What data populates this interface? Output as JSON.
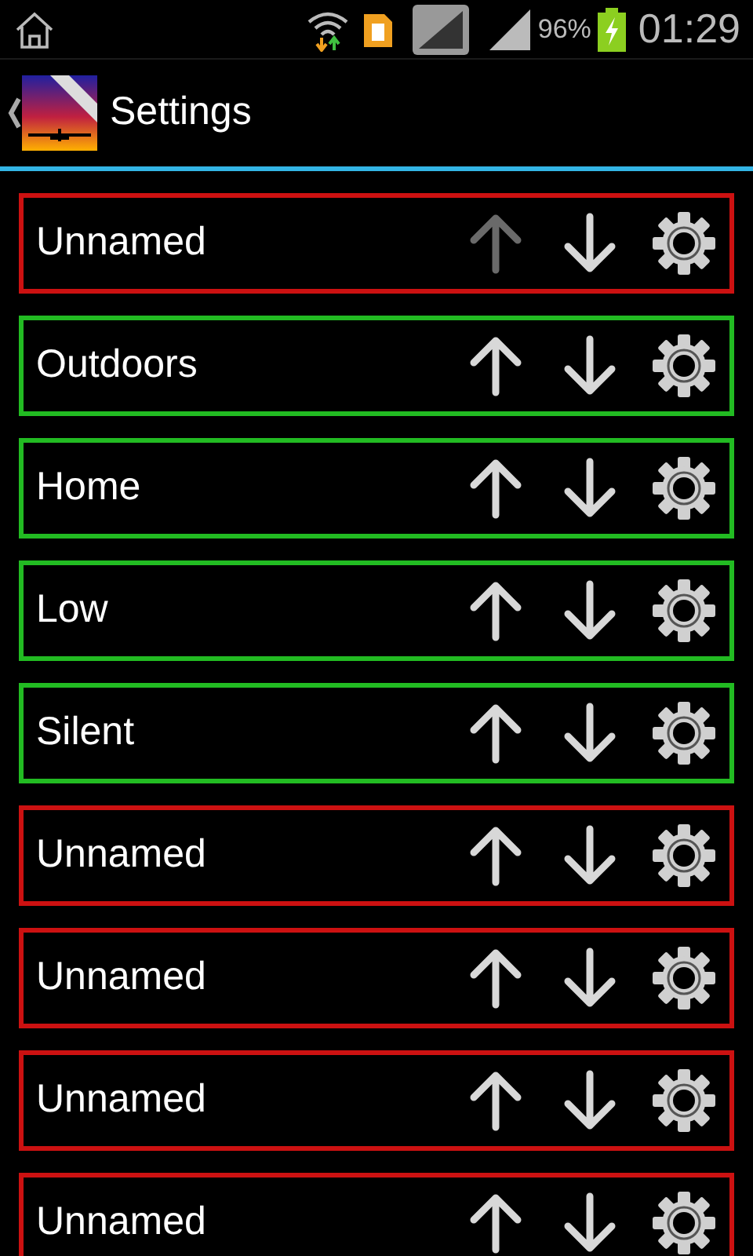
{
  "status_bar": {
    "battery": "96%",
    "time": "01:29"
  },
  "header": {
    "title": "Settings"
  },
  "profiles": [
    {
      "name": "Unnamed",
      "color": "#cc1111",
      "up_disabled": true
    },
    {
      "name": "Outdoors",
      "color": "#22bb22",
      "up_disabled": false
    },
    {
      "name": "Home",
      "color": "#22bb22",
      "up_disabled": false
    },
    {
      "name": "Low",
      "color": "#22bb22",
      "up_disabled": false
    },
    {
      "name": "Silent",
      "color": "#22bb22",
      "up_disabled": false
    },
    {
      "name": "Unnamed",
      "color": "#cc1111",
      "up_disabled": false
    },
    {
      "name": "Unnamed",
      "color": "#cc1111",
      "up_disabled": false
    },
    {
      "name": "Unnamed",
      "color": "#cc1111",
      "up_disabled": false
    },
    {
      "name": "Unnamed",
      "color": "#cc1111",
      "up_disabled": false
    }
  ]
}
